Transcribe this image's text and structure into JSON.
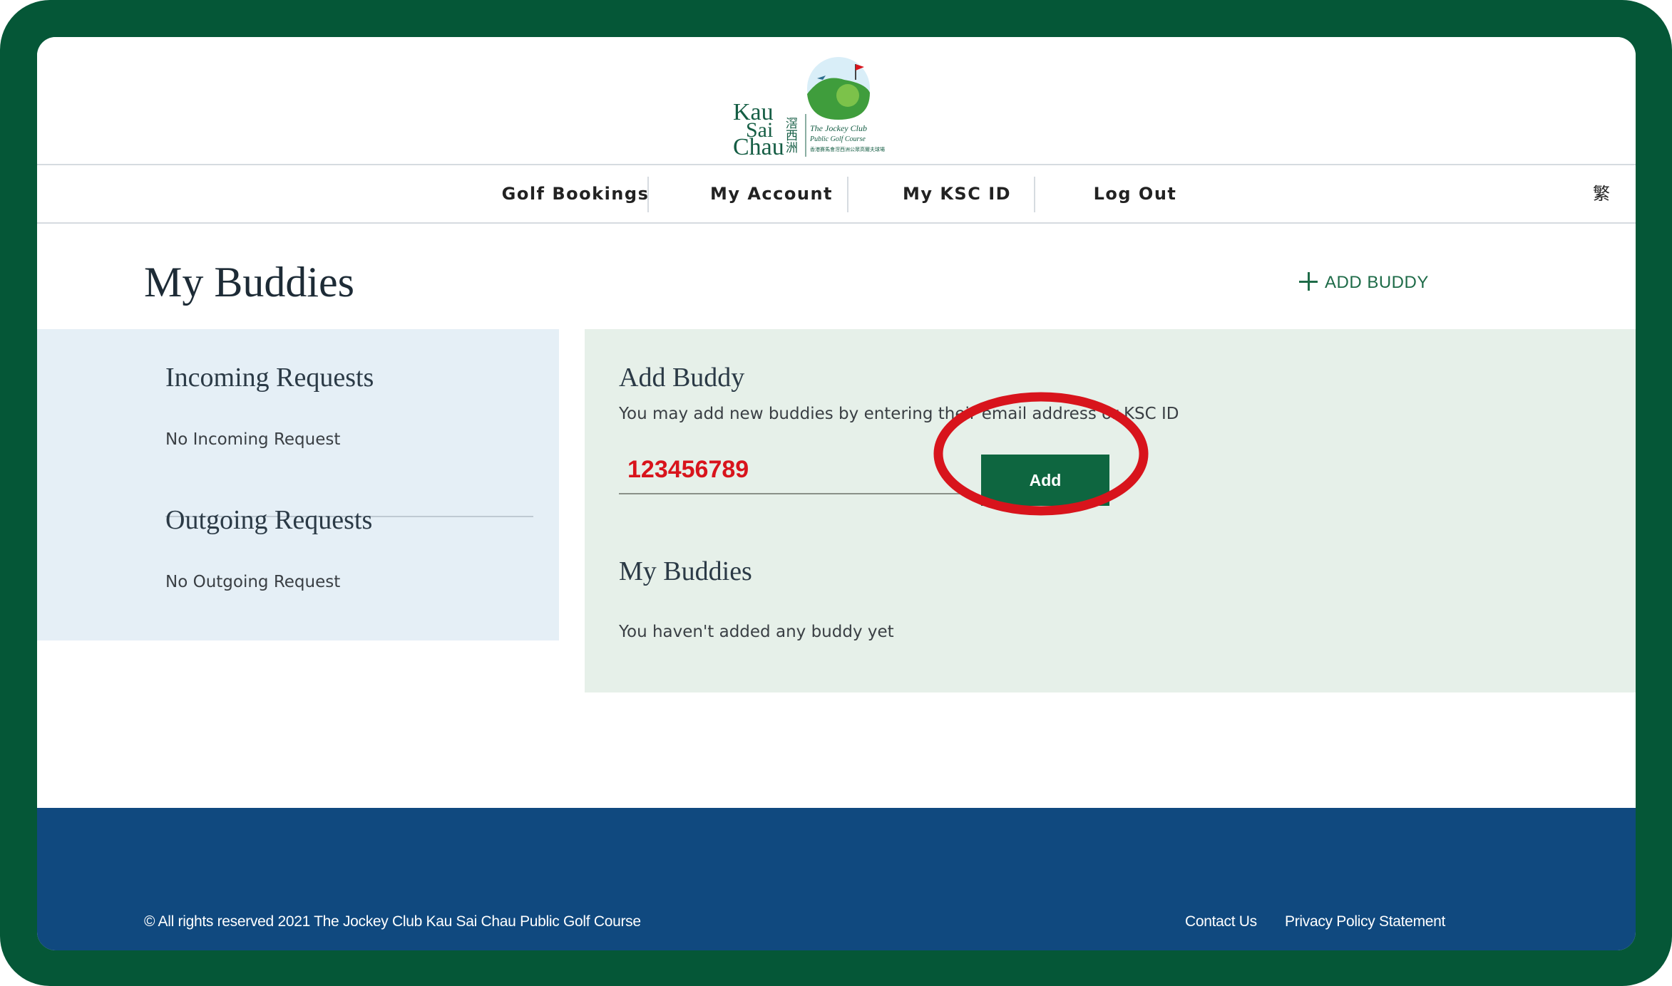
{
  "brand": {
    "name_en_lines": [
      "Kau",
      "Sai",
      "Chau"
    ],
    "name_zh": "滘西洲",
    "subtitle_lines": [
      "The Jockey Club",
      "Public Golf Course",
      "香港賽馬會滘西洲公眾高爾夫球場"
    ]
  },
  "nav": {
    "items": [
      {
        "label": "Golf Bookings"
      },
      {
        "label": "My Account"
      },
      {
        "label": "My KSC ID"
      },
      {
        "label": "Log Out"
      }
    ],
    "language_toggle": "繁"
  },
  "page": {
    "title": "My Buddies",
    "add_buddy_link": "ADD BUDDY"
  },
  "requests": {
    "incoming_title": "Incoming Requests",
    "incoming_empty": "No Incoming Request",
    "outgoing_title": "Outgoing Requests",
    "outgoing_empty": "No Outgoing Request"
  },
  "add_buddy": {
    "title": "Add Buddy",
    "description": "You may add new buddies by entering their email address or KSC ID",
    "input_value": "123456789",
    "button_label": "Add"
  },
  "my_buddies": {
    "title": "My Buddies",
    "empty": "You haven't added any buddy yet"
  },
  "footer": {
    "copyright": "© All rights reserved 2021  The Jockey Club Kau Sai Chau Public Golf Course",
    "links": [
      {
        "label": "Contact Us"
      },
      {
        "label": "Privacy Policy Statement"
      }
    ]
  },
  "colors": {
    "frame": "#055737",
    "brand_green": "#0e6640",
    "left_panel_bg": "#e5eff6",
    "right_panel_bg": "#e6f0e9",
    "footer_bg": "#10497f",
    "highlight_red": "#d8141c"
  }
}
